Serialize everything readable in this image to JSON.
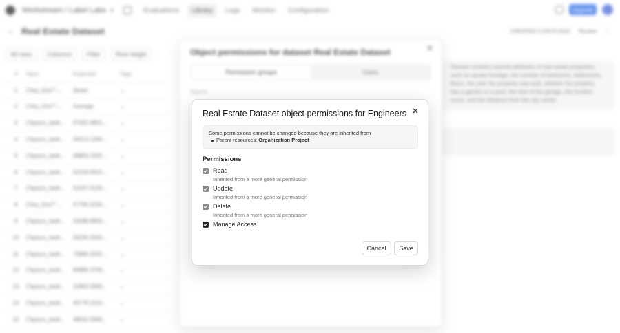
{
  "app": {
    "project_name": "Workstream / Label Labs",
    "nav": [
      "Evaluations",
      "Library",
      "Logs",
      "Monitor",
      "Configuration"
    ],
    "active_nav": 1,
    "upgrade_label": "Upgrade"
  },
  "dataset_page": {
    "title": "Real Estate Dataset",
    "right_meta": "CREATED 5 DAYS AGO",
    "right_action": "Review",
    "toolbar": [
      "All rows",
      "Columns",
      "Filter",
      "Row height"
    ],
    "table_headers": [
      "#",
      "Input",
      "Expected",
      "Tags"
    ],
    "row_ids": [
      "1",
      "2",
      "3",
      "4",
      "5",
      "6",
      "7",
      "8",
      "9",
      "10",
      "11",
      "12",
      "13",
      "14",
      "15"
    ],
    "row_inputs": [
      "{\"key_01e7\":...",
      "{\"key_01e7\":...",
      "{\"bpzyrs_bedr...",
      "{\"bpzyrs_bedr...",
      "{\"bpzyrs_bedr...",
      "{\"bpzyrs_bedr...",
      "{\"bpzyrs_bedr...",
      "{\"key_01e7\":...",
      "{\"bpzyrs_bedr...",
      "{\"bpzyrs_bedr...",
      "{\"bpzyrs_bedr...",
      "{\"bpzyrs_bedr...",
      "{\"bpzyrs_bedr...",
      "{\"bpzyrs_bedr...",
      "{\"bpzyrs_bedr..."
    ],
    "row_expected": [
      "Street",
      "Average",
      "67502.4801...",
      "59213.1290...",
      "69803.1502...",
      "52233.0910...",
      "51027.5120...",
      "57785.5230...",
      "53288.9950...",
      "56230.2500...",
      "73885.3202...",
      "80886.3700...",
      "22803.2830...",
      "45778.1510...",
      "49542.5990..."
    ],
    "description": "Dataset contains several attributes of real estate properties such as square footage, the number of bedrooms, bathrooms, floors, the year the property was built, whether the property has a garden or a pool, the size of the garage, the location score, and the distance from the city center."
  },
  "outer_dialog": {
    "title": "Object permissions for dataset Real Estate Dataset",
    "tabs": [
      "Permission groups",
      "Users"
    ],
    "active_tab": 0,
    "search_placeholder": "Search"
  },
  "modal": {
    "title": "Real Estate Dataset object permissions for Engineers",
    "notice_text": "Some permissions cannot be changed because they are inherited from",
    "notice_item_prefix": "Parent resources: ",
    "notice_item_value": "Organization Project",
    "permissions_heading": "Permissions",
    "permissions": [
      {
        "label": "Read",
        "inherited_note": "Inherited from a more general permission",
        "checked": true,
        "inherited": true
      },
      {
        "label": "Update",
        "inherited_note": "Inherited from a more general permission",
        "checked": true,
        "inherited": true
      },
      {
        "label": "Delete",
        "inherited_note": "Inherited from a more general permission",
        "checked": true,
        "inherited": true
      },
      {
        "label": "Manage Access",
        "inherited_note": "",
        "checked": true,
        "inherited": false
      }
    ],
    "cancel_label": "Cancel",
    "save_label": "Save",
    "close_icon": "close-icon"
  }
}
